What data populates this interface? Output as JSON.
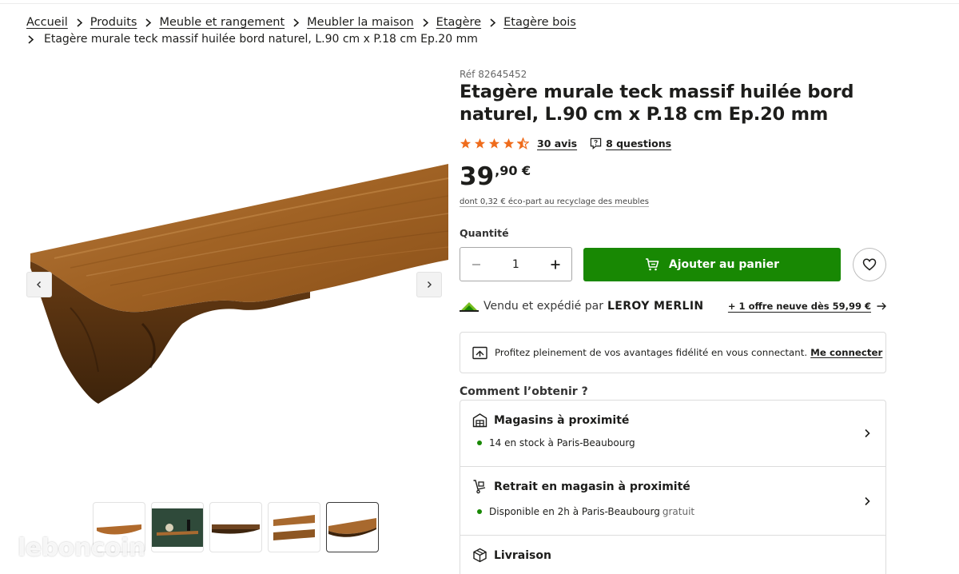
{
  "breadcrumb": {
    "items": [
      "Accueil",
      "Produits",
      "Meuble et rangement",
      "Meubler la maison",
      "Etagère",
      "Etagère bois"
    ],
    "current": "Etagère murale teck massif huilée bord naturel, L.90 cm x P.18 cm Ep.20 mm"
  },
  "product": {
    "ref": "Réf 82645452",
    "title": "Etagère murale teck massif huilée bord naturel, L.90 cm x P.18 cm Ep.20 mm",
    "rating": 4.5,
    "reviews_label": "30 avis",
    "questions_label": "8 questions",
    "price_int": "39",
    "price_dec": ",90 €",
    "eco_part": "dont 0,32 € éco-part au recyclage des meubles"
  },
  "purchase": {
    "quantity_label": "Quantité",
    "quantity_value": "1",
    "add_to_cart_label": "Ajouter au panier"
  },
  "seller": {
    "text": "Vendu et expédié par",
    "name": "LEROY MERLIN",
    "offers_label": "+ 1 offre neuve dès 59,99 €"
  },
  "loyalty": {
    "text": "Profitez pleinement de vos avantages fidélité en vous connectant.",
    "connect_label": "Me connecter"
  },
  "delivery": {
    "heading": "Comment l’obtenir ?",
    "options": [
      {
        "title": "Magasins à proximité",
        "detail": "14 en stock à Paris-Beaubourg",
        "note": ""
      },
      {
        "title": "Retrait en magasin à proximité",
        "detail": "Disponible en 2h à Paris-Beaubourg",
        "note": "gratuit"
      },
      {
        "title": "Livraison",
        "detail": "",
        "note": ""
      }
    ]
  },
  "gallery": {
    "thumbnail_count": 5,
    "active_thumbnail": 5
  },
  "watermark": "leboncoin",
  "colors": {
    "accent_green": "#188803",
    "star_orange": "#ef6c1c",
    "text": "#1d1d1b",
    "wood": "#a8692e"
  }
}
